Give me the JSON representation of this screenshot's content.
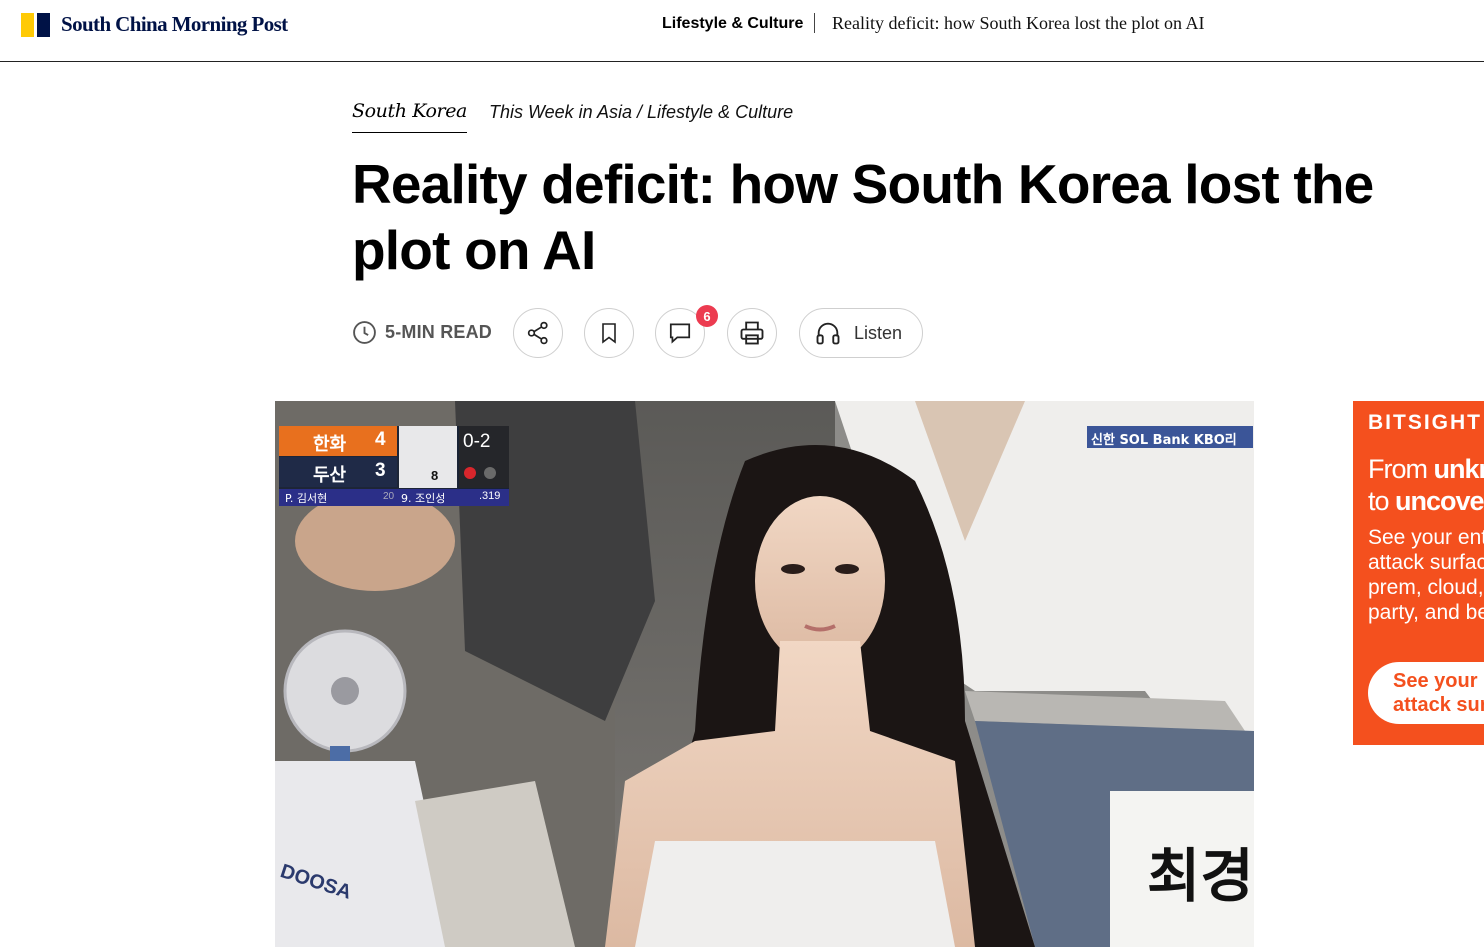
{
  "header": {
    "brand": "South China Morning Post",
    "section": "Lifestyle & Culture",
    "headline": "Reality deficit: how South Korea lost the plot on AI",
    "colors": {
      "brand_yellow": "#FFCA05",
      "brand_navy": "#001246"
    }
  },
  "breadcrumb": {
    "main": "South Korea",
    "sub": "This Week in Asia / Lifestyle & Culture"
  },
  "article": {
    "title": "Reality deficit: how South Korea lost the plot on AI"
  },
  "toolbar": {
    "read_time": "5-MIN READ",
    "comment_count": "6",
    "listen_label": "Listen",
    "icons": [
      "clock-icon",
      "share-icon",
      "bookmark-icon",
      "comment-icon",
      "print-icon",
      "headphones-icon"
    ],
    "badge_color": "#ec3b50"
  },
  "hero": {
    "scoreboard": {
      "team1": "한화",
      "score1": "4",
      "team2": "두산",
      "score2": "3",
      "count": "0-2",
      "outs_marker": "8",
      "pitcher": "P. 김서현",
      "pitcher_no": "20",
      "batter": "9. 조인성",
      "avg": ".319"
    },
    "broadcast_logo": "신한 SOL Bank KBO리",
    "jersey_text": "DOOSA",
    "sign_text": "최경"
  },
  "ad": {
    "brand": "BITSIGHT",
    "headline_regular_1": "From ",
    "headline_bold_1": "unknown",
    "headline_regular_2": "to ",
    "headline_bold_2": "uncovered",
    "body": "See your entire\nattack surface:\nprem, cloud, third\nparty, and beyond",
    "cta": "See your\nattack surface",
    "color": "#f4501e"
  }
}
